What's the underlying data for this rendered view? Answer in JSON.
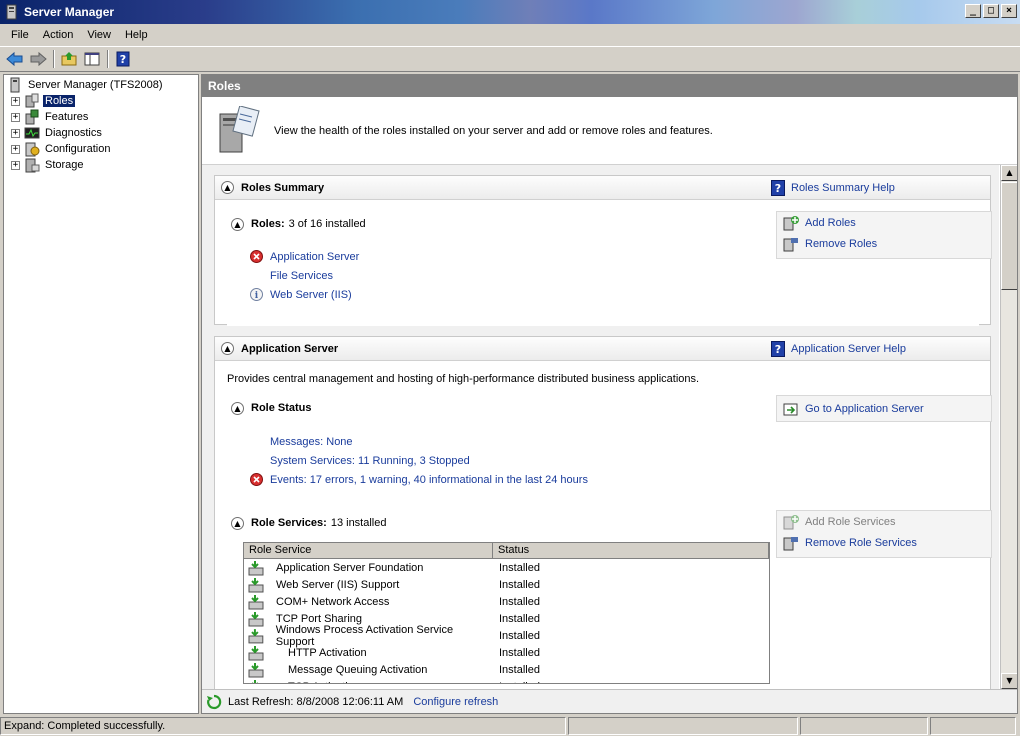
{
  "window": {
    "title": "Server Manager"
  },
  "menu": [
    "File",
    "Action",
    "View",
    "Help"
  ],
  "tree": {
    "root": "Server Manager (TFS2008)",
    "items": [
      {
        "label": "Roles",
        "selected": true
      },
      {
        "label": "Features"
      },
      {
        "label": "Diagnostics"
      },
      {
        "label": "Configuration"
      },
      {
        "label": "Storage"
      }
    ]
  },
  "panel": {
    "title": "Roles",
    "intro": "View the health of the roles installed on your server and add or remove roles and features."
  },
  "roles_summary": {
    "title": "Roles Summary",
    "help_link": "Roles Summary Help",
    "roles_label": "Roles:",
    "roles_count": "3 of 16 installed",
    "roles": [
      "Application Server",
      "File Services",
      "Web Server (IIS)"
    ],
    "actions": {
      "add": "Add Roles",
      "remove": "Remove Roles"
    }
  },
  "app_server": {
    "title": "Application Server",
    "help_link": "Application Server Help",
    "description": "Provides central management and hosting of high-performance distributed business applications.",
    "role_status": {
      "title": "Role Status",
      "go_link": "Go to Application Server",
      "messages": "Messages: None",
      "system_services": "System Services: 11 Running, 3 Stopped",
      "events": "Events: 17 errors, 1 warning, 40 informational in the last 24 hours"
    },
    "role_services": {
      "title": "Role Services:",
      "count": "13 installed",
      "add": "Add Role Services",
      "remove": "Remove Role Services",
      "columns": [
        "Role Service",
        "Status"
      ],
      "rows": [
        {
          "name": "Application Server Foundation",
          "status": "Installed",
          "indent": false
        },
        {
          "name": "Web Server (IIS) Support",
          "status": "Installed",
          "indent": false
        },
        {
          "name": "COM+ Network Access",
          "status": "Installed",
          "indent": false
        },
        {
          "name": "TCP Port Sharing",
          "status": "Installed",
          "indent": false
        },
        {
          "name": "Windows Process Activation Service Support",
          "status": "Installed",
          "indent": false
        },
        {
          "name": "HTTP Activation",
          "status": "Installed",
          "indent": true
        },
        {
          "name": "Message Queuing Activation",
          "status": "Installed",
          "indent": true
        },
        {
          "name": "TCP Activation",
          "status": "Installed",
          "indent": true
        }
      ]
    }
  },
  "refresh": {
    "last_refresh": "Last Refresh: 8/8/2008 12:06:11 AM",
    "configure": "Configure refresh"
  },
  "statusbar": {
    "text": "Expand:  Completed successfully."
  }
}
